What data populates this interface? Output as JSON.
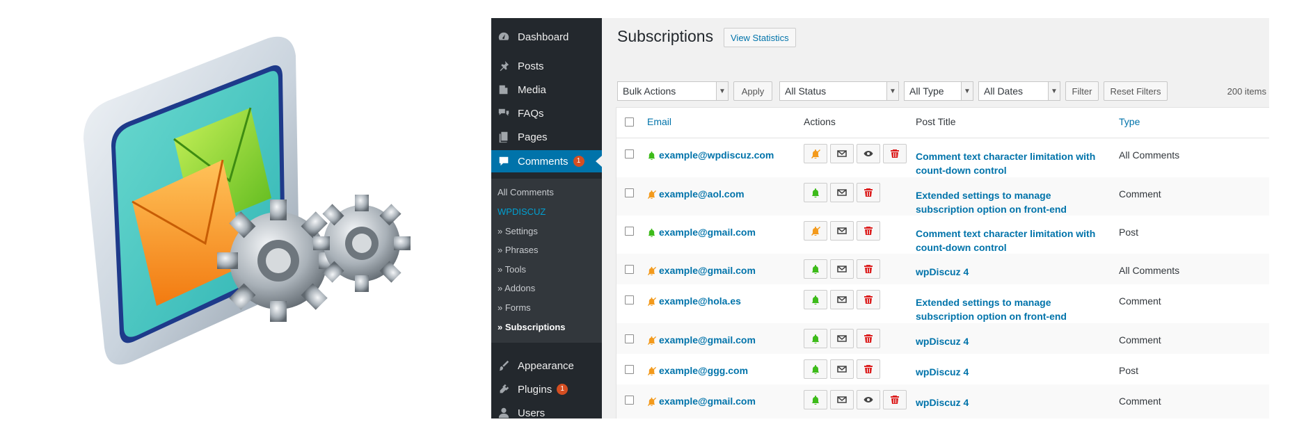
{
  "colors": {
    "admin_bar": "#23282d",
    "submenu_bg": "#32373c",
    "accent": "#0073aa",
    "badge": "#d54e21",
    "bell_on": "#3dbb1a",
    "bell_off": "#f39a1c",
    "delete": "#dc1f1f"
  },
  "illustration": {
    "icon": "email-subscription-settings-icon"
  },
  "sidebar": {
    "items": [
      {
        "label": "Dashboard",
        "icon": "dashboard-icon"
      },
      {
        "label": "Posts",
        "icon": "pin-icon"
      },
      {
        "label": "Media",
        "icon": "media-icon"
      },
      {
        "label": "FAQs",
        "icon": "comments-icon"
      },
      {
        "label": "Pages",
        "icon": "pages-icon"
      },
      {
        "label": "Comments",
        "icon": "comment-icon",
        "badge": "1"
      },
      {
        "label": "Appearance",
        "icon": "paintbrush-icon"
      },
      {
        "label": "Plugins",
        "icon": "plugin-icon",
        "badge": "1"
      },
      {
        "label": "Users",
        "icon": "user-icon"
      }
    ],
    "submenu": [
      "All Comments",
      "WPDISCUZ",
      "» Settings",
      "» Phrases",
      "» Tools",
      "» Addons",
      "» Forms",
      "» Subscriptions"
    ]
  },
  "header": {
    "title": "Subscriptions",
    "view_statistics": "View Statistics"
  },
  "toolbar": {
    "bulk_actions": "Bulk Actions",
    "apply": "Apply",
    "status": "All Status",
    "type": "All Type",
    "dates": "All Dates",
    "filter": "Filter",
    "reset": "Reset Filters",
    "count": "200 items"
  },
  "table": {
    "columns": [
      "Email",
      "Actions",
      "Post Title",
      "Type"
    ],
    "rows": [
      {
        "email": "example@wpdiscuz.com",
        "subscribed": true,
        "actions": [
          "bell-off",
          "mail",
          "eye",
          "trash"
        ],
        "post_title": "Comment text character limitation with count-down control",
        "type": "All Comments"
      },
      {
        "email": "example@aol.com",
        "subscribed": false,
        "actions": [
          "bell-on",
          "mail",
          "trash"
        ],
        "post_title": "Extended settings to manage subscription option on front-end",
        "type": "Comment"
      },
      {
        "email": "example@gmail.com",
        "subscribed": true,
        "actions": [
          "bell-off",
          "mail",
          "trash"
        ],
        "post_title": "Comment text character limitation with count-down control",
        "type": "Post"
      },
      {
        "email": "example@gmail.com",
        "subscribed": false,
        "actions": [
          "bell-on",
          "mail",
          "trash"
        ],
        "post_title": "wpDiscuz 4",
        "type": "All Comments"
      },
      {
        "email": "example@hola.es",
        "subscribed": false,
        "actions": [
          "bell-on",
          "mail",
          "trash"
        ],
        "post_title": "Extended settings to manage subscription option on front-end",
        "type": "Comment"
      },
      {
        "email": "example@gmail.com",
        "subscribed": false,
        "actions": [
          "bell-on",
          "mail",
          "trash"
        ],
        "post_title": "wpDiscuz 4",
        "type": "Comment"
      },
      {
        "email": "example@ggg.com",
        "subscribed": false,
        "actions": [
          "bell-on",
          "mail",
          "trash"
        ],
        "post_title": "wpDiscuz 4",
        "type": "Post"
      },
      {
        "email": "example@gmail.com",
        "subscribed": false,
        "actions": [
          "bell-on",
          "mail",
          "eye",
          "trash"
        ],
        "post_title": "wpDiscuz 4",
        "type": "Comment"
      }
    ]
  }
}
